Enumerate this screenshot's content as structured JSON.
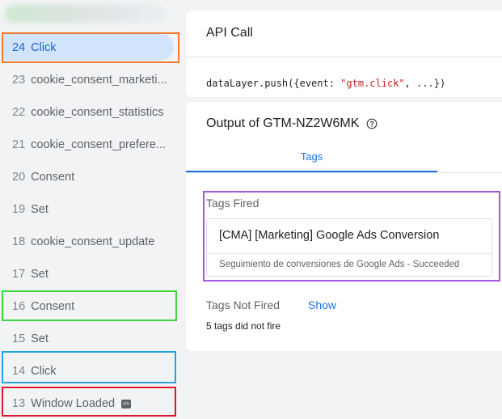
{
  "colors": {
    "selected_bg": "#d2e3fc",
    "accent_blue": "#1a73e8",
    "highlight_orange": "#f07a2f",
    "highlight_green": "#3dd63d",
    "highlight_cyan": "#25a3e0",
    "highlight_red": "#d9192a",
    "highlight_purple": "#a259e0"
  },
  "events": [
    {
      "num": "24",
      "label": "Click"
    },
    {
      "num": "23",
      "label": "cookie_consent_marketi..."
    },
    {
      "num": "22",
      "label": "cookie_consent_statistics"
    },
    {
      "num": "21",
      "label": "cookie_consent_prefere..."
    },
    {
      "num": "20",
      "label": "Consent"
    },
    {
      "num": "19",
      "label": "Set"
    },
    {
      "num": "18",
      "label": "cookie_consent_update"
    },
    {
      "num": "17",
      "label": "Set"
    },
    {
      "num": "16",
      "label": "Consent"
    },
    {
      "num": "15",
      "label": "Set"
    },
    {
      "num": "14",
      "label": "Click"
    },
    {
      "num": "13",
      "label": "Window Loaded",
      "badge": "code-icon"
    }
  ],
  "api_call": {
    "title": "API Call",
    "code_prefix": "dataLayer.push({event: ",
    "code_event": "\"gtm.click\"",
    "code_suffix": ", ...})"
  },
  "output": {
    "title": "Output of GTM-NZ2W6MK",
    "help_icon": "help-circle-icon",
    "tab_label": "Tags",
    "fired_label": "Tags Fired",
    "fired_tag": {
      "name": "[CMA] [Marketing] Google Ads Conversion",
      "status": "Seguimiento de conversiones de Google Ads - Succeeded"
    },
    "not_fired_label": "Tags Not Fired",
    "show_label": "Show",
    "not_fired_count": "5 tags did not fire"
  }
}
